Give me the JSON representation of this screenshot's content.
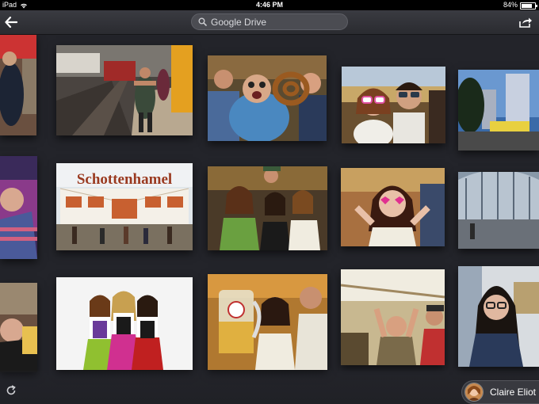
{
  "status_bar": {
    "device": "iPad",
    "time": "4:46 PM",
    "battery_text": "84%",
    "battery_level": 0.84
  },
  "nav": {
    "search_text": "Google Drive",
    "back_icon": "arrow-left-icon",
    "share_icon": "share-icon",
    "search_icon": "search-icon"
  },
  "user": {
    "name": "Claire Eliot"
  },
  "photos": [
    {
      "id": "p1",
      "desc": "street"
    },
    {
      "id": "p2",
      "desc": "train-station"
    },
    {
      "id": "p3",
      "desc": "man-with-pretzel"
    },
    {
      "id": "p4",
      "desc": "couple-sunglasses"
    },
    {
      "id": "p5",
      "desc": "city-night"
    },
    {
      "id": "p6",
      "desc": "woman-left"
    },
    {
      "id": "p7",
      "desc": "schottenhamel-tent"
    },
    {
      "id": "p8",
      "desc": "group-dirndl"
    },
    {
      "id": "p9",
      "desc": "woman-heart-glasses"
    },
    {
      "id": "p10",
      "desc": "station-roof"
    },
    {
      "id": "p11",
      "desc": "woman-beer"
    },
    {
      "id": "p12",
      "desc": "three-women-dirndl"
    },
    {
      "id": "p13",
      "desc": "beer-mug"
    },
    {
      "id": "p14",
      "desc": "men-celebrating"
    },
    {
      "id": "p15",
      "desc": "woman-glasses"
    }
  ],
  "tent_sign": "Schottenhamel",
  "colors": {
    "background": "#23242a",
    "navbar": "#2f3035"
  },
  "footer": {
    "refresh_icon": "refresh-icon"
  }
}
